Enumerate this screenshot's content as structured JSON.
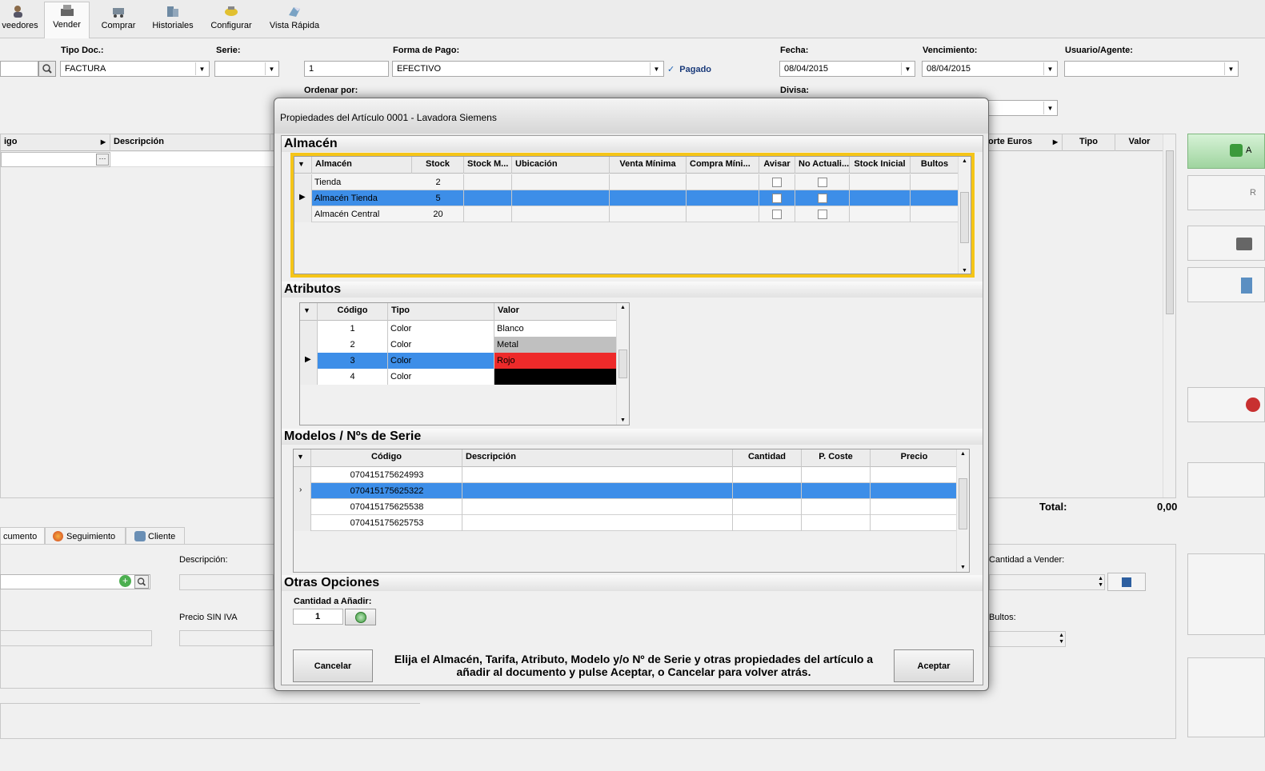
{
  "toolbar": {
    "items": [
      {
        "label": "veedores",
        "icon": "users-icon"
      },
      {
        "label": "Vender",
        "icon": "cash-register-icon"
      },
      {
        "label": "Comprar",
        "icon": "cart-icon"
      },
      {
        "label": "Historiales",
        "icon": "history-icon"
      },
      {
        "label": "Configurar",
        "icon": "tools-icon"
      },
      {
        "label": "Vista Rápida",
        "icon": "quick-view-icon"
      }
    ]
  },
  "header": {
    "tipo_doc_label": "Tipo Doc.:",
    "tipo_doc_value": "FACTURA",
    "serie_label": "Serie:",
    "serie_value": "",
    "numero_value": "1",
    "forma_pago_label": "Forma de Pago:",
    "forma_pago_value": "EFECTIVO",
    "pagado_label": "Pagado",
    "fecha_label": "Fecha:",
    "fecha_value": "08/04/2015",
    "vencimiento_label": "Vencimiento:",
    "vencimiento_value": "08/04/2015",
    "usuario_label": "Usuario/Agente:",
    "usuario_value": "",
    "ordenar_label": "Ordenar por:",
    "divisa_label": "Divisa:"
  },
  "main_grid": {
    "col_codigo": "igo",
    "col_descripcion": "Descripción",
    "col_importe": "orte Euros",
    "col_tipo": "Tipo",
    "col_valor": "Valor",
    "total_label": "Total:",
    "total_value": "0,00"
  },
  "bottom": {
    "tabs": [
      "cumento",
      "Seguimiento",
      "Cliente"
    ],
    "descripcion_label": "Descripción:",
    "precio_label": "Precio SIN IVA",
    "cantidad_vender_label": "Cantidad a Vender:",
    "bultos_label": "Bultos:"
  },
  "side_buttons": {
    "top_label": "A",
    "second_label": "R"
  },
  "dialog": {
    "title": "Propiedades del Artículo 0001 - Lavadora Siemens",
    "almacen": {
      "section_title": "Almacén",
      "columns": [
        "Almacén",
        "Stock",
        "Stock M...",
        "Ubicación",
        "Venta Mínima",
        "Compra Míni...",
        "Avisar",
        "No Actuali...",
        "Stock Inicial",
        "Bultos"
      ],
      "rows": [
        {
          "almacen": "Tienda",
          "stock": "2"
        },
        {
          "almacen": "Almacén Tienda",
          "stock": "5"
        },
        {
          "almacen": "Almacén Central",
          "stock": "20"
        }
      ]
    },
    "atributos": {
      "section_title": "Atributos",
      "columns": [
        "Código",
        "Tipo",
        "Valor"
      ],
      "rows": [
        {
          "codigo": "1",
          "tipo": "Color",
          "valor": "Blanco",
          "color": "#ffffff"
        },
        {
          "codigo": "2",
          "tipo": "Color",
          "valor": "Metal",
          "color": "#c0c0c0"
        },
        {
          "codigo": "3",
          "tipo": "Color",
          "valor": "Rojo",
          "color": "#ee2a2a"
        },
        {
          "codigo": "4",
          "tipo": "Color",
          "valor": "",
          "color": "#000000"
        }
      ]
    },
    "modelos": {
      "section_title": "Modelos / Nºs de Serie",
      "columns": [
        "Código",
        "Descripción",
        "Cantidad",
        "P. Coste",
        "Precio"
      ],
      "rows": [
        {
          "codigo": "070415175624993"
        },
        {
          "codigo": "070415175625322"
        },
        {
          "codigo": "070415175625538"
        },
        {
          "codigo": "070415175625753"
        }
      ]
    },
    "otras": {
      "section_title": "Otras Opciones",
      "cantidad_label": "Cantidad a Añadir:",
      "cantidad_value": "1"
    },
    "cancel_label": "Cancelar",
    "accept_label": "Aceptar",
    "help_text": "Elija el Almacén, Tarifa, Atributo, Modelo y/o Nº de Serie y otras propiedades del artículo a añadir al documento y pulse Aceptar, o Cancelar para volver atrás."
  },
  "colors": {
    "selection": "#3d8ee8",
    "highlight_border": "#f5c518"
  }
}
